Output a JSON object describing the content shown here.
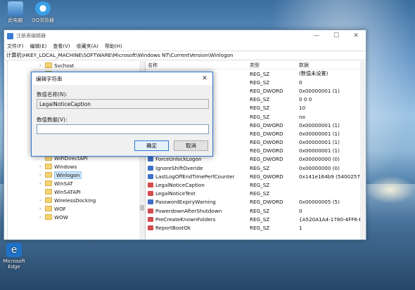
{
  "desktop": {
    "icons": [
      {
        "label": "此电脑"
      },
      {
        "label": "QQ浏览器"
      },
      {
        "label": "Microsoft Edge"
      }
    ]
  },
  "regedit": {
    "title": "注册表编辑器",
    "window_controls": {
      "minimize": "—",
      "maximize": "☐",
      "close": "✕"
    },
    "menu": [
      "文件(F)",
      "编辑(E)",
      "查看(V)",
      "收藏夹(A)",
      "帮助(H)"
    ],
    "address": "计算机\\HKEY_LOCAL_MACHINE\\SOFTWARE\\Microsoft\\Windows NT\\CurrentVersion\\Winlogon",
    "tree": [
      {
        "label": "Svchost",
        "expandable": true
      },
      {
        "label": "",
        "expandable": false
      },
      {
        "label": "",
        "expandable": false
      },
      {
        "label": "",
        "expandable": false
      },
      {
        "label": "",
        "expandable": false
      },
      {
        "label": "",
        "expandable": false
      },
      {
        "label": "",
        "expandable": false
      },
      {
        "label": "",
        "expandable": false
      },
      {
        "label": "",
        "expandable": false
      },
      {
        "label": "",
        "expandable": false
      },
      {
        "label": "WbemPerf",
        "expandable": false
      },
      {
        "label": "WiFiDirectAPI",
        "expandable": false
      },
      {
        "label": "Windows",
        "expandable": true
      },
      {
        "label": "Winlogon",
        "expandable": true,
        "selected": true
      },
      {
        "label": "WinSAT",
        "expandable": true
      },
      {
        "label": "WinSATAPI",
        "expandable": false
      },
      {
        "label": "WirelessDocking",
        "expandable": true
      },
      {
        "label": "WOF",
        "expandable": true
      },
      {
        "label": "WOW",
        "expandable": true
      }
    ],
    "columns": {
      "name": "名称",
      "type": "类型",
      "data": "数据"
    },
    "values": [
      {
        "name": "",
        "type": "REG_SZ",
        "data": "(数值未设置)",
        "kind": "sz"
      },
      {
        "name": "",
        "type": "REG_SZ",
        "data": "0",
        "kind": "sz"
      },
      {
        "name": "",
        "type": "REG_DWORD",
        "data": "0x00000001 (1)",
        "kind": "dw"
      },
      {
        "name": "",
        "type": "REG_SZ",
        "data": "0 0 0",
        "kind": "sz"
      },
      {
        "name": "",
        "type": "REG_SZ",
        "data": "10",
        "kind": "sz"
      },
      {
        "name": "",
        "type": "REG_SZ",
        "data": "no",
        "kind": "sz"
      },
      {
        "name": "",
        "type": "REG_DWORD",
        "data": "0x00000001 (1)",
        "kind": "dw"
      },
      {
        "name": "",
        "type": "REG_DWORD",
        "data": "0x00000001 (1)",
        "kind": "dw"
      },
      {
        "name": "on",
        "type": "REG_DWORD",
        "data": "0x00000001 (1)",
        "kind": "dw"
      },
      {
        "name": "",
        "type": "REG_DWORD",
        "data": "0x00000001 (1)",
        "kind": "dw"
      },
      {
        "name": "ForceUnlockLogon",
        "type": "REG_DWORD",
        "data": "0x00000000 (0)",
        "kind": "dw"
      },
      {
        "name": "IgnoreShiftOveride",
        "type": "REG_SZ",
        "data": "0x00000000 (0)",
        "kind": "dw"
      },
      {
        "name": "LastLogOffEndTimePerfCounter",
        "type": "REG_QWORD",
        "data": "0x141e164b9 (54002577",
        "kind": "dw"
      },
      {
        "name": "LegalNoticeCaption",
        "type": "REG_SZ",
        "data": "",
        "kind": "sz"
      },
      {
        "name": "LegalNoticeText",
        "type": "REG_SZ",
        "data": "",
        "kind": "sz"
      },
      {
        "name": "PasswordExpiryWarning",
        "type": "REG_DWORD",
        "data": "0x00000005 (5)",
        "kind": "dw"
      },
      {
        "name": "PowerdownAfterShutdown",
        "type": "REG_SZ",
        "data": "0",
        "kind": "sz"
      },
      {
        "name": "PreCreateKnownFolders",
        "type": "REG_SZ",
        "data": "{A520A1A4-1780-4FF6-BI",
        "kind": "sz"
      },
      {
        "name": "ReportBootOk",
        "type": "REG_SZ",
        "data": "1",
        "kind": "sz"
      }
    ]
  },
  "dialog": {
    "title": "编辑字符串",
    "close": "✕",
    "name_label": "数值名称(N):",
    "name_value": "LegalNoticeCaption",
    "data_label": "数值数据(V):",
    "data_value": "",
    "ok": "确定",
    "cancel": "取消"
  }
}
